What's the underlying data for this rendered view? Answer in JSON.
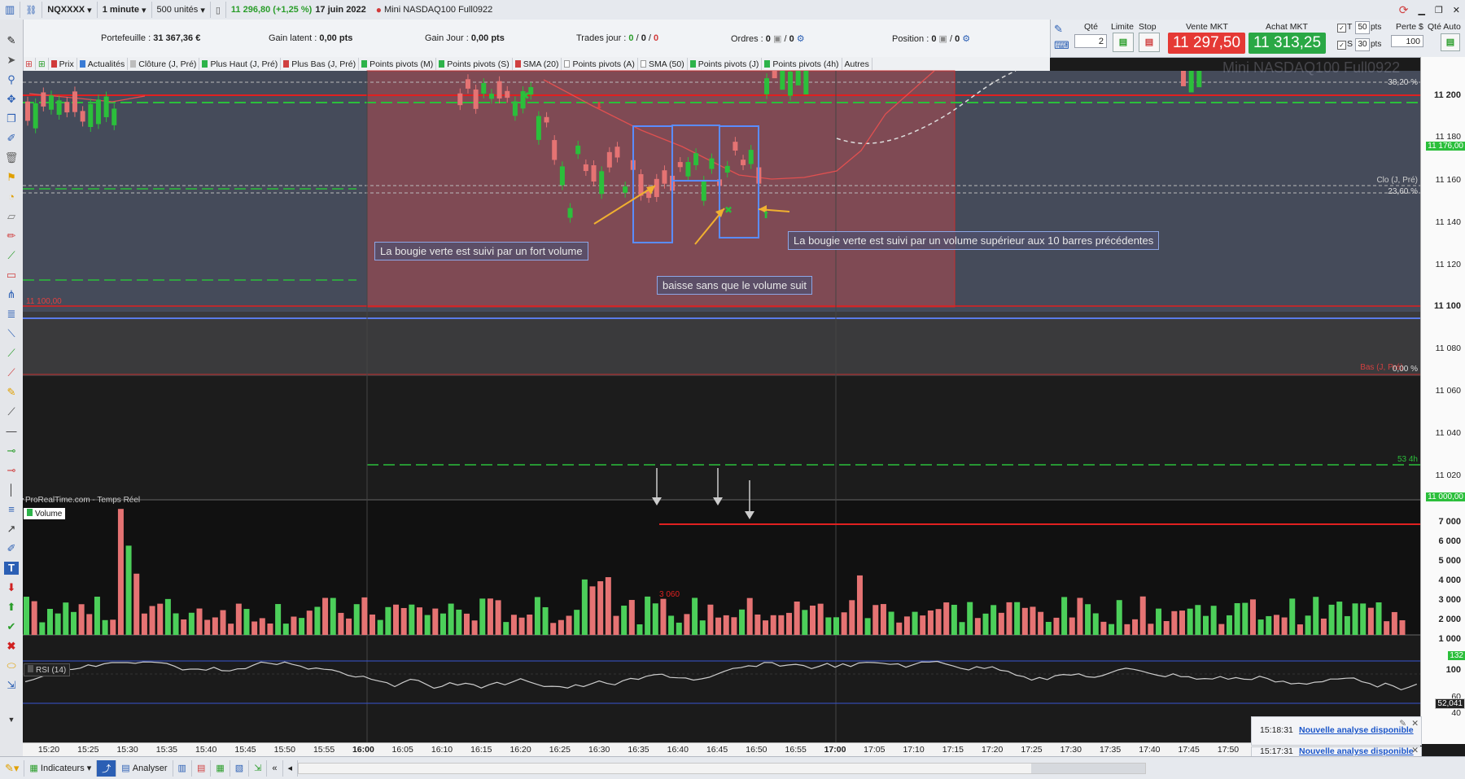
{
  "topbar": {
    "symbol": "NQXXXX",
    "interval": "1 minute",
    "units": "500 unités",
    "price_change": "11 296,80 (+1,25 %)",
    "date": "17 juin 2022",
    "instrument": "Mini NASDAQ100 Full0922"
  },
  "portfolio": {
    "portefeuille_label": "Portefeuille :",
    "portefeuille_value": "31 367,36 €",
    "gain_latent_label": "Gain latent :",
    "gain_latent_value": "0,00 pts",
    "gain_jour_label": "Gain Jour :",
    "gain_jour_value": "0,00 pts",
    "trades_label": "Trades jour :",
    "trades_v1": "0",
    "trades_v2": "0",
    "trades_v3": "0",
    "ordres_label": "Ordres :",
    "ordres_v1": "0",
    "ordres_v2": "0",
    "position_label": "Position :",
    "position_v1": "0",
    "position_v2": "0"
  },
  "trade": {
    "qte_label": "Qté",
    "qte_value": "2",
    "limite_label": "Limite",
    "stop_label": "Stop",
    "vente_label": "Vente MKT",
    "vente_value": "11 297,50",
    "achat_label": "Achat MKT",
    "achat_value": "11 313,25",
    "t_label": "T",
    "t_value": "50",
    "t_unit": "pts",
    "s_label": "S",
    "s_value": "30",
    "s_unit": "pts",
    "perte_label": "Perte $",
    "perte_value": "100",
    "qte_auto_label": "Qté Auto"
  },
  "tabs": [
    {
      "label": "Prix",
      "color": "#d03a3a"
    },
    {
      "label": "Actualités",
      "color": "#3a7bd5"
    },
    {
      "label": "Clôture (J, Pré)",
      "color": "#bdbdbd"
    },
    {
      "label": "Plus Haut (J, Pré)",
      "color": "#2db34a"
    },
    {
      "label": "Plus Bas (J, Pré)",
      "color": "#d04040"
    },
    {
      "label": "Points pivots (M)",
      "color": "#2db34a"
    },
    {
      "label": "Points pivots (S)",
      "color": "#2db34a"
    },
    {
      "label": "SMA (20)",
      "color": "#d04040"
    },
    {
      "label": "Points pivots (A)",
      "color": "#ffffff"
    },
    {
      "label": "SMA (50)",
      "color": "#ffffff"
    },
    {
      "label": "Points pivots (J)",
      "color": "#2db34a"
    },
    {
      "label": "Points pivots (4h)",
      "color": "#2db34a"
    },
    {
      "label": "Autres",
      "color": "#eeeeee"
    }
  ],
  "chart": {
    "watermark": "Mini NASDAQ100 Full0922",
    "source": "ProRealTime.com - Temps Réel",
    "volume_label": "Volume",
    "rsi_label": "RSI (14)",
    "fib_382": "38,20 %",
    "fib_236": "23,60 %",
    "fib_0": "0,00 %",
    "clo_label": "Clo (J, Pré)",
    "bas_label": "Bas (J, Pré)",
    "level_label_11100": "11 100,00",
    "level_label_534": "53 4h",
    "vol_ref_label": "3 060",
    "price_tag_11176": "11 176,00",
    "price_tag_11000": "11 000,00",
    "vol_tag": "132",
    "rsi_tag": "52,041",
    "annotations": {
      "a1": "La bougie verte est suivi par un fort volume",
      "a2": "baisse sans que le volume suit",
      "a3": "La bougie verte est suivi par un volume supérieur aux 10 barres précédentes"
    }
  },
  "price_axis": [
    "11 200",
    "11 180",
    "11 160",
    "11 140",
    "11 120",
    "11 100",
    "11 080",
    "11 060",
    "11 040",
    "11 020"
  ],
  "volume_axis": [
    "7 000",
    "6 000",
    "5 000",
    "4 000",
    "3 000",
    "2 000",
    "1 000"
  ],
  "rsi_axis": [
    "100",
    "60",
    "40"
  ],
  "time_axis": [
    "15:20",
    "15:25",
    "15:30",
    "15:35",
    "15:40",
    "15:45",
    "15:50",
    "15:55",
    "16:00",
    "16:05",
    "16:10",
    "16:15",
    "16:20",
    "16:25",
    "16:30",
    "16:35",
    "16:40",
    "16:45",
    "16:50",
    "16:55",
    "17:00",
    "17:05",
    "17:10",
    "17:15",
    "17:20",
    "17:25",
    "17:30",
    "17:35",
    "17:40",
    "17:45",
    "17:50"
  ],
  "notifications": [
    {
      "time": "15:18:31",
      "text": "Nouvelle analyse disponible"
    },
    {
      "time": "15:17:31",
      "text": "Nouvelle analyse disponible"
    }
  ],
  "bottombar": {
    "indicateurs": "Indicateurs",
    "analyser": "Analyser"
  }
}
